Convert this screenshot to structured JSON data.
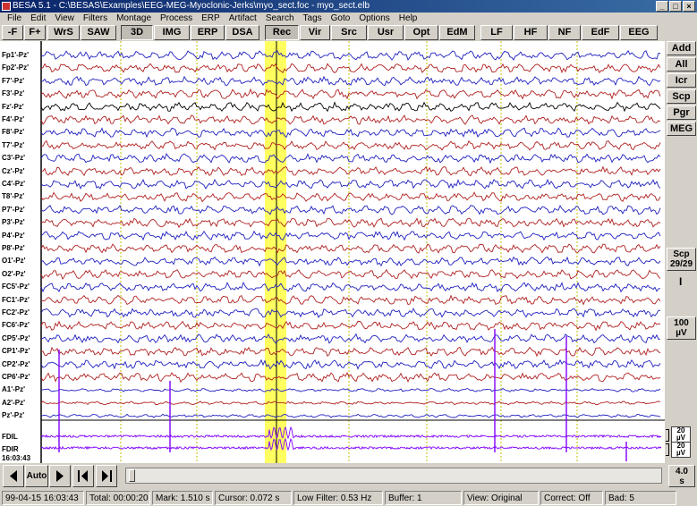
{
  "window": {
    "title": "BESA 5.1 - C:\\BESAS\\Examples\\EEG-MEG-Myoclonic-Jerks\\myo_sect.foc - myo_sect.elb",
    "controls": [
      "_",
      "□",
      "×"
    ]
  },
  "menu": [
    "File",
    "Edit",
    "View",
    "Filters",
    "Montage",
    "Process",
    "ERP",
    "Artifact",
    "Search",
    "Tags",
    "Goto",
    "Options",
    "Help"
  ],
  "toolbar": [
    {
      "label": "-F",
      "pressed": false
    },
    {
      "label": "F+",
      "pressed": false
    },
    {
      "label": "WrS",
      "pressed": false
    },
    {
      "label": "SAW",
      "pressed": false
    },
    {
      "label": "3D",
      "pressed": true
    },
    {
      "label": "IMG",
      "pressed": false
    },
    {
      "label": "ERP",
      "pressed": false
    },
    {
      "label": "DSA",
      "pressed": false
    },
    {
      "label": "Rec",
      "pressed": true
    },
    {
      "label": "Vir",
      "pressed": false
    },
    {
      "label": "Src",
      "pressed": false
    },
    {
      "label": "Usr",
      "pressed": false
    },
    {
      "label": "Opt",
      "pressed": false
    },
    {
      "label": "EdM",
      "pressed": false
    },
    {
      "label": "LF",
      "pressed": false
    },
    {
      "label": "HF",
      "pressed": false
    },
    {
      "label": "NF",
      "pressed": false
    },
    {
      "label": "EdF",
      "pressed": false
    },
    {
      "label": "EEG",
      "pressed": false
    }
  ],
  "channels": [
    "Fp1'-Pz'",
    "Fp2'-Pz'",
    "F7'-Pz'",
    "F3'-Pz'",
    "Fz'-Pz'",
    "F4'-Pz'",
    "F8'-Pz'",
    "T7'-Pz'",
    "C3'-Pz'",
    "Cz'-Pz'",
    "C4'-Pz'",
    "T8'-Pz'",
    "P7'-Pz'",
    "P3'-Pz'",
    "P4'-Pz'",
    "P8'-Pz'",
    "O1'-Pz'",
    "O2'-Pz'",
    "FC5'-Pz'",
    "FC1'-Pz'",
    "FC2'-Pz'",
    "FC6'-Pz'",
    "CP5'-Pz'",
    "CP1'-Pz'",
    "CP2'-Pz'",
    "CP6'-Pz'",
    "A1'-Pz'",
    "A2'-Pz'",
    "Pz'-Pz'"
  ],
  "emg_channels": [
    "FDIL",
    "FDIR"
  ],
  "time_label": "16:03:43",
  "colors": {
    "eeg_blue": "#2020c0",
    "eeg_red": "#b02020",
    "eeg_black": "#000000",
    "emg_purple": "#8000ff",
    "highlight": "#ffff60",
    "marker": "#c0c000"
  },
  "right_panel": {
    "buttons": [
      "Add",
      "All",
      "Icr",
      "Scp",
      "Pgr",
      "MEG"
    ],
    "scp_label": "Scp",
    "scp_count": "29/29",
    "scale_value": "100",
    "scale_unit": "µV",
    "emg_scale_1": "20",
    "emg_scale_2": "20",
    "emg_unit": "µV"
  },
  "nav": {
    "auto_label": "Auto",
    "page_len": "4.0",
    "page_unit": "s"
  },
  "status": {
    "datetime": "99-04-15  16:03:43",
    "total": "Total: 00:00:20",
    "mark": "Mark: 1.510 s",
    "cursor": "Cursor: 0.072 s",
    "low_filter": "Low Filter: 0.53 Hz",
    "buffer": "Buffer: 1",
    "view": "View: Original",
    "correct": "Correct: Off",
    "bad": "Bad: 5"
  }
}
